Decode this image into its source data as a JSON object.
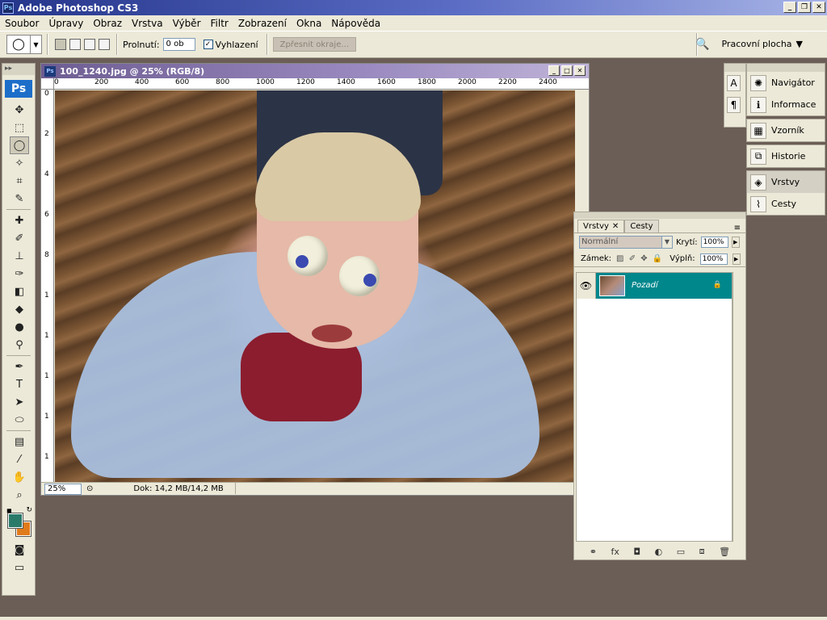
{
  "window": {
    "title": "Adobe Photoshop CS3",
    "app_badge": "Ps"
  },
  "menu": [
    "Soubor",
    "Úpravy",
    "Obraz",
    "Vrstva",
    "Výběr",
    "Filtr",
    "Zobrazení",
    "Okna",
    "Nápověda"
  ],
  "options": {
    "feather_label": "Prolnutí:",
    "feather_value": "0 ob",
    "antialias_label": "Vyhlazení",
    "antialias_checked": true,
    "refine_edge_label": "Zpřesnit okraje...",
    "workspace_label": "Pracovní plocha"
  },
  "toolbox": {
    "badge": "Ps"
  },
  "document": {
    "title": "100_1240.jpg @ 25% (RGB/8)",
    "zoom": "25%",
    "doc_info": "Dok: 14,2 MB/14,2 MB",
    "ruler_h": [
      "0",
      "200",
      "400",
      "600",
      "800",
      "1000",
      "1200",
      "1400",
      "1600",
      "1800",
      "2000",
      "2200",
      "2400"
    ],
    "ruler_v": [
      "0",
      "2",
      "4",
      "6",
      "8",
      "1",
      "1",
      "1",
      "1",
      "1",
      "1"
    ]
  },
  "dock": {
    "items": [
      {
        "label": "Navigátor",
        "icon": "navigator-icon"
      },
      {
        "label": "Informace",
        "icon": "info-icon"
      },
      {
        "label": "Vzorník",
        "icon": "swatches-icon"
      },
      {
        "label": "Historie",
        "icon": "history-icon"
      },
      {
        "label": "Vrstvy",
        "icon": "layers-icon"
      },
      {
        "label": "Cesty",
        "icon": "paths-icon"
      }
    ]
  },
  "layers_panel": {
    "tabs": [
      "Vrstvy",
      "Cesty"
    ],
    "blend_mode": "Normální",
    "opacity_label": "Krytí:",
    "opacity_value": "100%",
    "lock_label": "Zámek:",
    "fill_label": "Výplň:",
    "fill_value": "100%",
    "layers": [
      {
        "name": "Pozadí",
        "visible": true,
        "locked": true
      }
    ]
  },
  "colors": {
    "foreground": "#2a7a6a",
    "background": "#e07b1c",
    "layer_selected": "#00878c"
  }
}
